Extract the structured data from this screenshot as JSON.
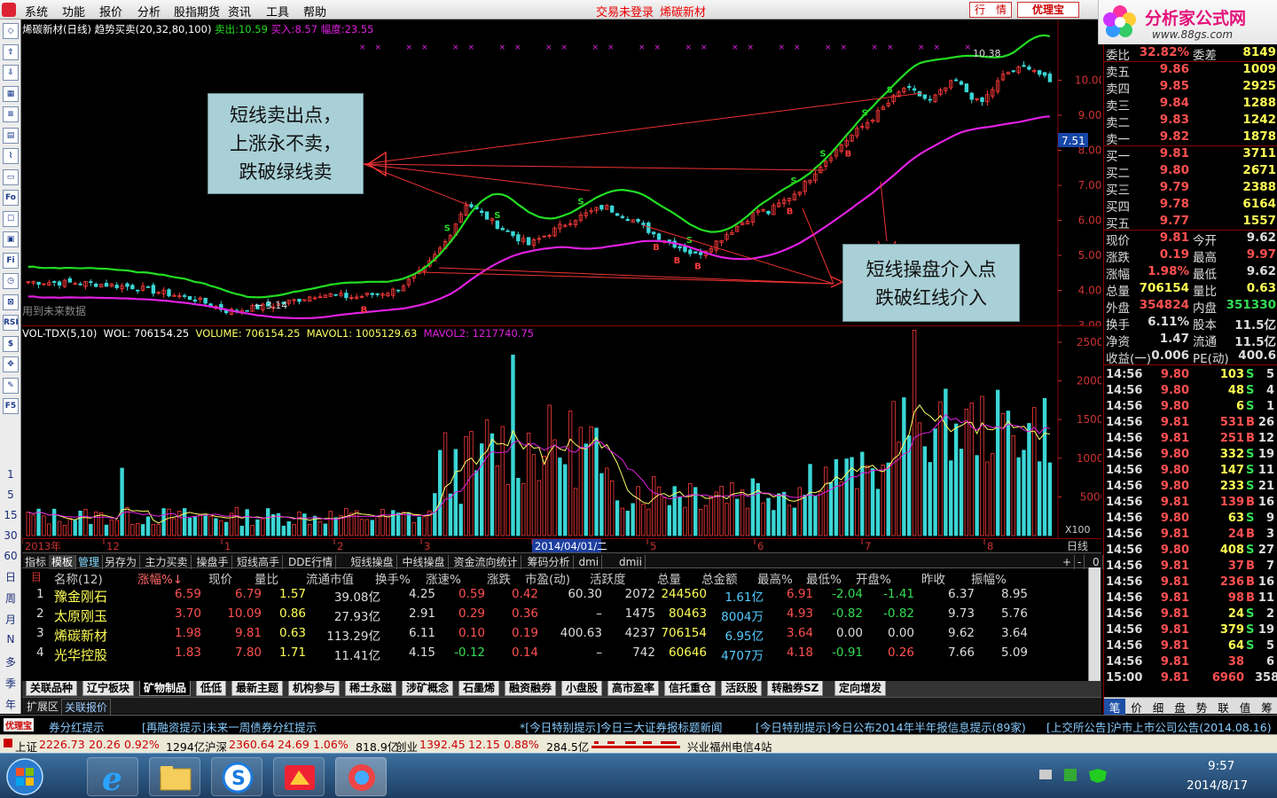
{
  "menu": {
    "items": [
      "系统",
      "功能",
      "报价",
      "分析",
      "股指期货",
      "资讯",
      "工具",
      "帮助"
    ],
    "status": "交易未登录",
    "status_stock": "烯碳新材",
    "btn_quote": "行　情",
    "btn_logo": "优理宝",
    "logo_text": "分析家公式网",
    "logo_url": "www.88gs.com"
  },
  "chart": {
    "title": "烯碳新材(日线)",
    "indicator": "趋势买卖(20,32,80,100)",
    "sell_label": "卖出:",
    "sell": "10.59",
    "buy_label": "买入:",
    "buy": "8.57",
    "amp_label": "幅度:",
    "amp": "23.55",
    "note": "用到未来数据",
    "high_label": "10.38",
    "low_label": "3.14",
    "marker_b": "B",
    "marker_s": "S",
    "price_marker": "7.51",
    "colors": {
      "green": "#22dd22",
      "magenta": "#e020e0",
      "up": "#ff3b3b",
      "down": "#3bd6d6"
    }
  },
  "chart_data": {
    "type": "candlestick+volume",
    "price_axis": [
      "10.00",
      "9.00",
      "8.00",
      "7.00",
      "6.00",
      "5.00",
      "4.00",
      "3.00"
    ],
    "volume_axis": [
      "25000",
      "20000",
      "15000",
      "10000",
      "5000"
    ],
    "volume_unit": "X100",
    "time_labels": [
      "2013年",
      "12",
      "1",
      "2",
      "3",
      "2014/04/01/二",
      "5",
      "6",
      "7",
      "8"
    ],
    "period": "日线"
  },
  "volume": {
    "title": "VOL-TDX(5,10)",
    "wol": "WOL: 706154.25",
    "vol": "VOLUME: 706154.25",
    "mavol1": "MAVOL1: 1005129.63",
    "mavol2": "MAVOL2: 1217740.75"
  },
  "callouts": {
    "sell": [
      "短线卖出点，",
      "上涨永不卖，",
      "跌破绿线卖"
    ],
    "buy": [
      "短线操盘介入点",
      "跌破红线介入"
    ]
  },
  "func_tabs": [
    "指标",
    "模板",
    "管理",
    "另存为",
    "主力买卖",
    "操盘手",
    "短线高手",
    "DDE行情",
    "短线操盘",
    "中线操盘",
    "资金流向统计",
    "筹码分析",
    "dmi",
    "dmii"
  ],
  "period_btns": [
    "日",
    "周",
    "月",
    "N",
    "多",
    "季",
    "年"
  ],
  "left_nums": [
    "1",
    "5",
    "15",
    "30",
    "60"
  ],
  "tools_glyphs": [
    "+",
    "-",
    "0"
  ],
  "table": {
    "count_label": "名称(12)",
    "headers": [
      "名称(12)",
      "涨幅%↓",
      "现价",
      "量比",
      "流通市值",
      "换手%",
      "涨速%",
      "涨跌",
      "市盈(动)",
      "活跃度",
      "总量",
      "总金额",
      "最高%",
      "最低%",
      "开盘%",
      "昨收",
      "振幅%"
    ],
    "rows": [
      {
        "idx": "1",
        "name": "豫金刚石",
        "chg": "6.59",
        "price": "6.79",
        "lb": "1.57",
        "mv": "39.08亿",
        "hs": "4.25",
        "zs": "0.59",
        "zd": "0.42",
        "pe": "60.30",
        "act": "2072",
        "vol": "244560",
        "amt": "1.61亿",
        "hi": "6.91",
        "lo": "-2.04",
        "op": "-1.41",
        "pc": "6.37",
        "zf": "8.95"
      },
      {
        "idx": "2",
        "name": "太原刚玉",
        "chg": "3.70",
        "price": "10.09",
        "lb": "0.86",
        "mv": "27.93亿",
        "hs": "2.91",
        "zs": "0.29",
        "zd": "0.36",
        "pe": "–",
        "act": "1475",
        "vol": "80463",
        "amt": "8004万",
        "hi": "4.93",
        "lo": "-0.82",
        "op": "-0.82",
        "pc": "9.73",
        "zf": "5.76"
      },
      {
        "idx": "3",
        "name": "烯碳新材",
        "chg": "1.98",
        "price": "9.81",
        "lb": "0.63",
        "mv": "113.29亿",
        "hs": "6.11",
        "zs": "0.10",
        "zd": "0.19",
        "pe": "400.63",
        "act": "4237",
        "vol": "706154",
        "amt": "6.95亿",
        "hi": "3.64",
        "lo": "0.00",
        "op": "0.00",
        "pc": "9.62",
        "zf": "3.64"
      },
      {
        "idx": "4",
        "name": "光华控股",
        "chg": "1.83",
        "price": "7.80",
        "lb": "1.71",
        "mv": "11.41亿",
        "hs": "4.15",
        "zs": "-0.12",
        "zd": "0.14",
        "pe": "–",
        "act": "742",
        "vol": "60646",
        "amt": "4707万",
        "hi": "4.18",
        "lo": "-0.91",
        "op": "0.26",
        "pc": "7.66",
        "zf": "5.09"
      }
    ]
  },
  "sector_tabs": [
    "关联品种",
    "辽宁板块",
    "矿物制品",
    "低低",
    "最新主题",
    "机构参与",
    "稀土永磁",
    "涉矿概念",
    "石墨烯",
    "融资融券",
    "小盘股",
    "高市盈率",
    "信托重仓",
    "活跃股",
    "转融券SZ",
    "定向增发"
  ],
  "ext_tabs": [
    "扩展区",
    "关联报价"
  ],
  "orderbook": {
    "code_hint": "000511 烯碳新材",
    "wb_label": "委比",
    "wb": "32.82%",
    "wc_label": "委差",
    "wc": "8149",
    "asks": [
      {
        "l": "卖五",
        "p": "9.86",
        "v": "1009"
      },
      {
        "l": "卖四",
        "p": "9.85",
        "v": "2925"
      },
      {
        "l": "卖三",
        "p": "9.84",
        "v": "1288"
      },
      {
        "l": "卖二",
        "p": "9.83",
        "v": "1242"
      },
      {
        "l": "卖一",
        "p": "9.82",
        "v": "1878"
      }
    ],
    "bids": [
      {
        "l": "买一",
        "p": "9.81",
        "v": "3711"
      },
      {
        "l": "买二",
        "p": "9.80",
        "v": "2671"
      },
      {
        "l": "买三",
        "p": "9.79",
        "v": "2388"
      },
      {
        "l": "买四",
        "p": "9.78",
        "v": "6164"
      },
      {
        "l": "买五",
        "p": "9.77",
        "v": "1557"
      }
    ],
    "stats": [
      {
        "a": "现价",
        "av": "9.81",
        "b": "今开",
        "bv": "9.62"
      },
      {
        "a": "涨跌",
        "av": "0.19",
        "b": "最高",
        "bv": "9.97"
      },
      {
        "a": "涨幅",
        "av": "1.98%",
        "b": "最低",
        "bv": "9.62"
      },
      {
        "a": "总量",
        "av": "706154",
        "b": "量比",
        "bv": "0.63"
      },
      {
        "a": "外盘",
        "av": "354824",
        "b": "内盘",
        "bv": "351330"
      },
      {
        "a": "换手",
        "av": "6.11%",
        "b": "股本",
        "bv": "11.5亿"
      },
      {
        "a": "净资",
        "av": "1.47",
        "b": "流通",
        "bv": "11.5亿"
      },
      {
        "a": "收益(一)",
        "av": "0.006",
        "b": "PE(动)",
        "bv": "400.6"
      }
    ]
  },
  "ticks": [
    {
      "t": "14:56",
      "p": "9.80",
      "v": "103",
      "d": "S",
      "n": "5"
    },
    {
      "t": "14:56",
      "p": "9.80",
      "v": "48",
      "d": "S",
      "n": "4"
    },
    {
      "t": "14:56",
      "p": "9.80",
      "v": "6",
      "d": "S",
      "n": "1"
    },
    {
      "t": "14:56",
      "p": "9.81",
      "v": "531",
      "d": "B",
      "n": "26"
    },
    {
      "t": "14:56",
      "p": "9.81",
      "v": "251",
      "d": "B",
      "n": "12"
    },
    {
      "t": "14:56",
      "p": "9.80",
      "v": "332",
      "d": "S",
      "n": "19"
    },
    {
      "t": "14:56",
      "p": "9.80",
      "v": "147",
      "d": "S",
      "n": "11"
    },
    {
      "t": "14:56",
      "p": "9.80",
      "v": "233",
      "d": "S",
      "n": "21"
    },
    {
      "t": "14:56",
      "p": "9.81",
      "v": "139",
      "d": "B",
      "n": "16"
    },
    {
      "t": "14:56",
      "p": "9.80",
      "v": "63",
      "d": "S",
      "n": "9"
    },
    {
      "t": "14:56",
      "p": "9.81",
      "v": "24",
      "d": "B",
      "n": "3"
    },
    {
      "t": "14:56",
      "p": "9.80",
      "v": "408",
      "d": "S",
      "n": "27"
    },
    {
      "t": "14:56",
      "p": "9.81",
      "v": "37",
      "d": "B",
      "n": "7"
    },
    {
      "t": "14:56",
      "p": "9.81",
      "v": "236",
      "d": "B",
      "n": "16"
    },
    {
      "t": "14:56",
      "p": "9.81",
      "v": "98",
      "d": "B",
      "n": "11"
    },
    {
      "t": "14:56",
      "p": "9.81",
      "v": "24",
      "d": "S",
      "n": "2"
    },
    {
      "t": "14:56",
      "p": "9.81",
      "v": "379",
      "d": "S",
      "n": "19"
    },
    {
      "t": "14:56",
      "p": "9.81",
      "v": "64",
      "d": "S",
      "n": "5"
    },
    {
      "t": "14:56",
      "p": "9.81",
      "v": "38",
      "d": "",
      "n": "6"
    },
    {
      "t": "15:00",
      "p": "9.81",
      "v": "6960",
      "d": "",
      "n": "358"
    }
  ],
  "right_tabs": [
    "笔",
    "价",
    "细",
    "盘",
    "势",
    "联",
    "值",
    "筹"
  ],
  "news": [
    "券分红提示",
    "[再融资提示]未来一周债券分红提示",
    "*[今日特别提示]今日三大证券报标题新闻",
    "[今日特别提示]今日公布2014年半年报信息提示(89家)",
    "[上交所公告]沪市上市公司公告(2014.08.16)"
  ],
  "news_logo": "优理宝",
  "index_bar": {
    "sh_label": "上证",
    "sh": "2226.73",
    "sh_chg": "20.26",
    "sh_pct": "0.92%",
    "sh_amt": "1294亿",
    "hs_label": "沪深",
    "hs": "2360.64",
    "hs_chg": "24.69",
    "hs_pct": "1.06%",
    "hs_amt": "818.9亿",
    "cy_label": "创业",
    "cy": "1392.45",
    "cy_chg": "12.15",
    "cy_pct": "0.88%",
    "cy_amt": "284.5亿",
    "server": "兴业福州电信4站"
  },
  "taskbar": {
    "time": "9:57",
    "date": "2014/8/17"
  }
}
